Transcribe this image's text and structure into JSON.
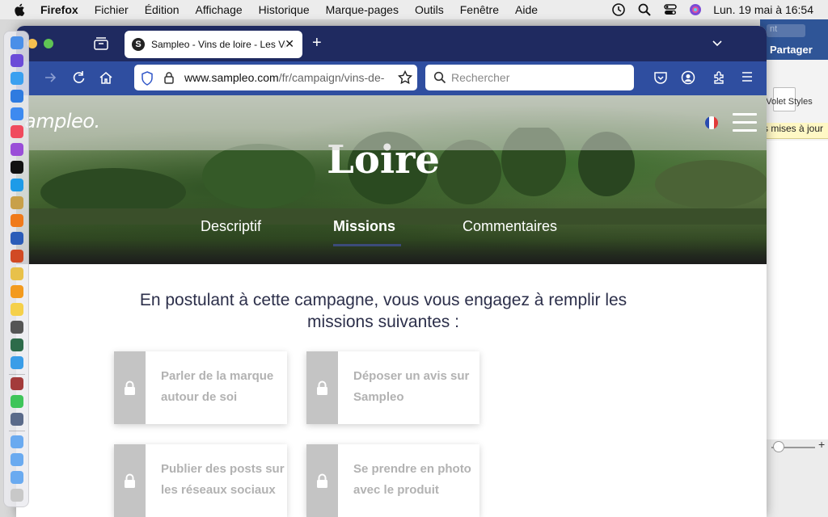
{
  "menubar": {
    "app": "Firefox",
    "items": [
      "Fichier",
      "Édition",
      "Affichage",
      "Historique",
      "Marque-pages",
      "Outils",
      "Fenêtre",
      "Aide"
    ],
    "clock": "Lun. 19 mai à 16:54"
  },
  "word_window": {
    "search_placeholder": "nt",
    "share": "Partager",
    "styles_pane": "Volet Styles",
    "notice": "s mises à jour"
  },
  "browser": {
    "tab_title": "Sampleo - Vins de loire - Les Vin",
    "tab_favicon": "S",
    "url_domain": "www.sampleo.com",
    "url_path": "/fr/campaign/vins-de-",
    "search_placeholder": "Rechercher"
  },
  "site": {
    "logo": "ampleo.",
    "hero_title": "Loire",
    "tabs": [
      "Descriptif",
      "Missions",
      "Commentaires"
    ],
    "active_tab": "Missions",
    "intro": "En postulant à cette campagne, vous vous engagez à remplir les missions suivantes :",
    "missions": [
      "Parler de la marque autour de soi",
      "Déposer un avis sur Sampleo",
      "Publier des posts sur les réseaux sociaux",
      "Se prendre en photo avec le produit"
    ]
  },
  "colors": {
    "tabbar": "#1f2a60",
    "navbar": "#2f4ea0",
    "lock_column": "#c4c4c4",
    "mission_text": "#b2b2b2",
    "intro_text": "#2c2f4a"
  }
}
